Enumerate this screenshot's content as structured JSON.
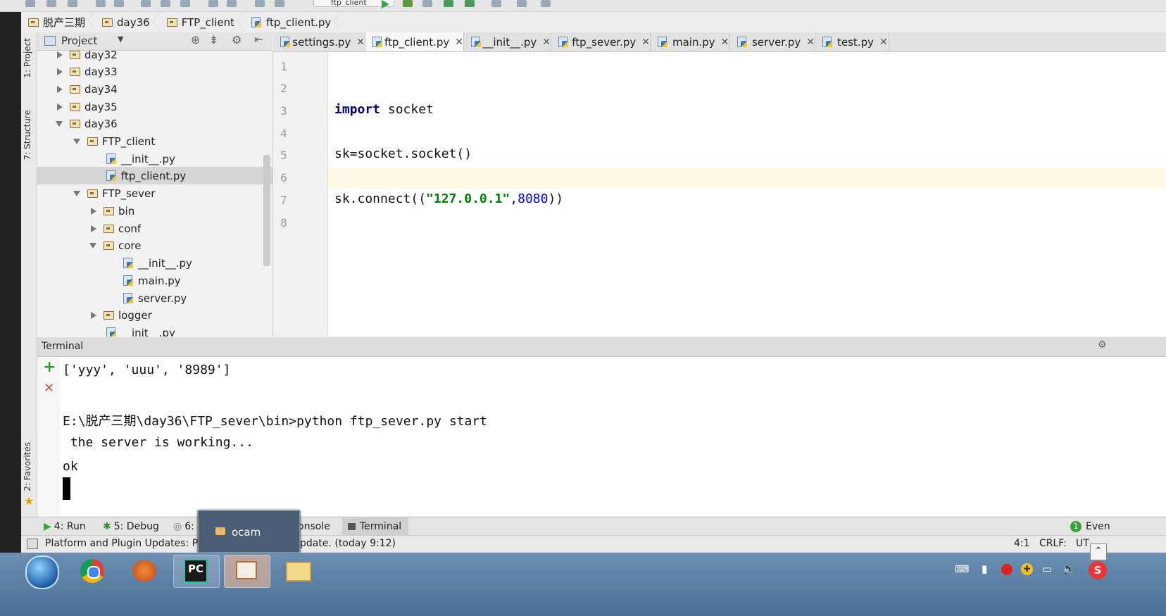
{
  "toolbar": {
    "run_config": "ftp_client"
  },
  "breadcrumb": [
    "脱产三期",
    "day36",
    "FTP_client",
    "ftp_client.py"
  ],
  "left_strip": {
    "project": "1: Project",
    "structure": "7: Structure",
    "favorites": "2: Favorites"
  },
  "project_panel": {
    "title": "Project",
    "tree": [
      {
        "label": "day32",
        "kind": "folder",
        "state": "collapsed"
      },
      {
        "label": "day33",
        "kind": "folder",
        "state": "collapsed"
      },
      {
        "label": "day34",
        "kind": "folder",
        "state": "collapsed"
      },
      {
        "label": "day35",
        "kind": "folder",
        "state": "collapsed"
      },
      {
        "label": "day36",
        "kind": "folder",
        "state": "expanded"
      },
      {
        "label": "FTP_client",
        "kind": "folder",
        "state": "expanded"
      },
      {
        "label": "__init__.py",
        "kind": "file"
      },
      {
        "label": "ftp_client.py",
        "kind": "file",
        "selected": true
      },
      {
        "label": "FTP_sever",
        "kind": "folder",
        "state": "expanded"
      },
      {
        "label": "bin",
        "kind": "folder",
        "state": "collapsed"
      },
      {
        "label": "conf",
        "kind": "folder",
        "state": "collapsed"
      },
      {
        "label": "core",
        "kind": "folder",
        "state": "expanded"
      },
      {
        "label": "__init__.py",
        "kind": "file"
      },
      {
        "label": "main.py",
        "kind": "file"
      },
      {
        "label": "server.py",
        "kind": "file"
      },
      {
        "label": "logger",
        "kind": "folder",
        "state": "collapsed"
      },
      {
        "label": "__init__.py",
        "kind": "file"
      }
    ]
  },
  "tabs": [
    {
      "label": "settings.py",
      "active": false
    },
    {
      "label": "ftp_client.py",
      "active": true
    },
    {
      "label": "__init__.py",
      "active": false
    },
    {
      "label": "ftp_sever.py",
      "active": false
    },
    {
      "label": "main.py",
      "active": false
    },
    {
      "label": "server.py",
      "active": false
    },
    {
      "label": "test.py",
      "active": false
    }
  ],
  "editor": {
    "line_numbers": [
      "1",
      "2",
      "3",
      "4",
      "5",
      "6",
      "7",
      "8"
    ],
    "lines": {
      "l3_kw": "import",
      "l3_rest": " socket",
      "l5": "sk=socket.socket()",
      "l7_a": "sk.connect((",
      "l7_str": "\"127.0.0.1\"",
      "l7_b": ",",
      "l7_num": "8080",
      "l7_c": "))"
    },
    "current_line": "6"
  },
  "terminal": {
    "title": "Terminal",
    "lines": [
      "['yyy', 'uuu', '8989']",
      "",
      "E:\\脱产三期\\day36\\FTP_sever\\bin>python ftp_sever.py start",
      " the server is working...",
      "ok"
    ]
  },
  "tool_windows": {
    "run": "4: Run",
    "debug": "5: Debug",
    "todo": "6:",
    "console": "onsole",
    "terminal": "Terminal",
    "event_log": "Even"
  },
  "ocam_popup": {
    "label": "ocam"
  },
  "status": {
    "message_left": "Platform and Plugin Updates: Py",
    "message_right": "pdate. (today 9:12)",
    "position": "4:1",
    "line_sep": "CRLF:",
    "encoding": "UT"
  },
  "colors": {
    "keyword": "#000080",
    "string": "#008000",
    "number": "#0000ff",
    "current_line": "#fffae3"
  }
}
